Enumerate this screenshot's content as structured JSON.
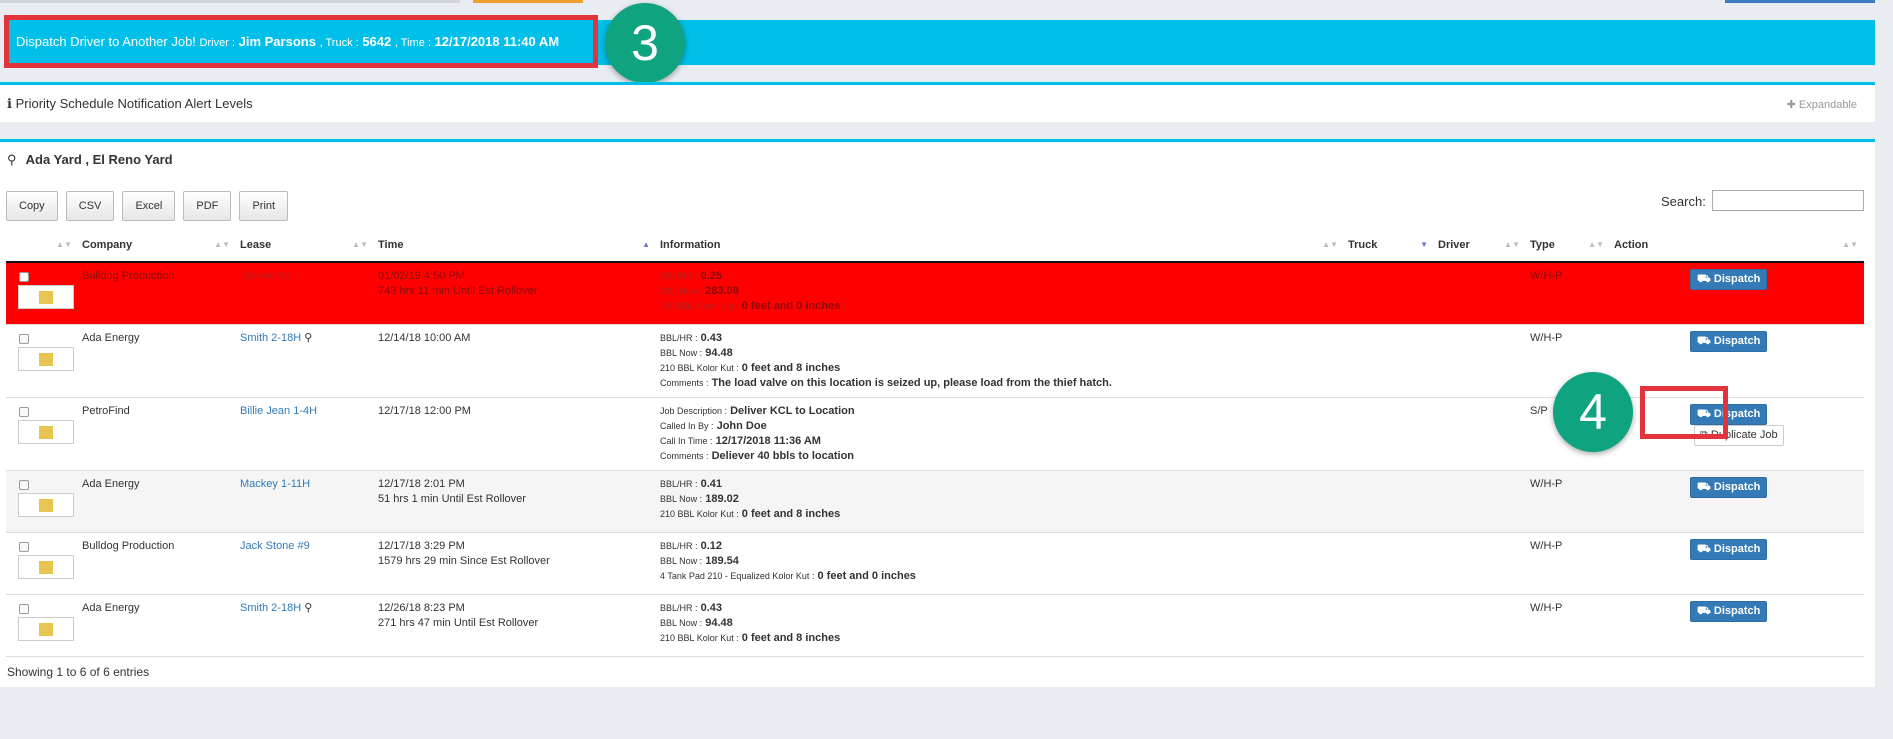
{
  "banner": {
    "title": "Dispatch Driver to Another Job!",
    "driver_label": "Driver :",
    "driver": "Jim Parsons",
    "truck_label": ", Truck :",
    "truck": "5642",
    "time_label": ", Time :",
    "time": "12/17/2018 11:40 AM"
  },
  "callouts": {
    "step3": "3",
    "step4": "4"
  },
  "alert_panel": {
    "title": "Priority Schedule Notification Alert Levels",
    "expand": "Expandable"
  },
  "yard": {
    "title": "Ada Yard , El Reno Yard"
  },
  "toolbar": {
    "buttons": [
      "Copy",
      "CSV",
      "Excel",
      "PDF",
      "Print"
    ],
    "search_label": "Search:"
  },
  "columns": [
    "",
    "Company",
    "Lease",
    "Time",
    "Information",
    "Truck",
    "Driver",
    "Type",
    "Action"
  ],
  "rows": [
    {
      "company": "Bulldog Production",
      "lease": "Denver #3",
      "has_pin": false,
      "time1": "01/02/19 4:50 PM",
      "time2": "749 hrs 11 min Until Est Rollover",
      "info": [
        {
          "label": "BBL/HR :",
          "value": "0.25"
        },
        {
          "label": "BBL Now :",
          "value": "283.08"
        },
        {
          "label": "300 BBL Kolor Kut :",
          "value": "0 feet and 0 inches"
        }
      ],
      "type": "W/H-P",
      "action": "Dispatch",
      "style": "red"
    },
    {
      "company": "Ada Energy",
      "lease": "Smith 2-18H",
      "has_pin": true,
      "time1": "12/14/18 10:00 AM",
      "time2": "",
      "info": [
        {
          "label": "BBL/HR :",
          "value": "0.43"
        },
        {
          "label": "BBL Now :",
          "value": "94.48"
        },
        {
          "label": "210 BBL Kolor Kut :",
          "value": "0 feet and 8 inches"
        },
        {
          "label": "Comments :",
          "value": "The load valve on this location is seized up, please load from the thief hatch."
        }
      ],
      "type": "W/H-P",
      "action": "Dispatch",
      "style": "white"
    },
    {
      "company": "PetroFind",
      "lease": "Billie Jean 1-4H",
      "has_pin": false,
      "time1": "12/17/18 12:00 PM",
      "time2": "",
      "info": [
        {
          "label": "Job Description :",
          "value": "Deliver KCL to Location"
        },
        {
          "label": "Called In By :",
          "value": "John Doe"
        },
        {
          "label": "Call In Time :",
          "value": "12/17/2018 11:36 AM"
        },
        {
          "label": "Comments :",
          "value": "Deliever 40 bbls to location"
        }
      ],
      "type": "S/P",
      "action": "Dispatch",
      "extra_action": "Duplicate Job",
      "style": "white"
    },
    {
      "company": "Ada Energy",
      "lease": "Mackey 1-11H",
      "has_pin": false,
      "time1": "12/17/18 2:01 PM",
      "time2": "51 hrs 1 min Until Est Rollover",
      "info": [
        {
          "label": "BBL/HR :",
          "value": "0.41"
        },
        {
          "label": "BBL Now :",
          "value": "189.02"
        },
        {
          "label": "210 BBL Kolor Kut :",
          "value": "0 feet and 8 inches"
        }
      ],
      "type": "W/H-P",
      "action": "Dispatch",
      "style": "alt"
    },
    {
      "company": "Bulldog Production",
      "lease": "Jack Stone #9",
      "has_pin": false,
      "time1": "12/17/18 3:29 PM",
      "time2": "1579 hrs 29 min Since Est Rollover",
      "info": [
        {
          "label": "BBL/HR :",
          "value": "0.12"
        },
        {
          "label": "BBL Now :",
          "value": "189.54"
        },
        {
          "label": "4 Tank Pad 210 - Equalized Kolor Kut :",
          "value": "0 feet and 0 inches"
        }
      ],
      "type": "W/H-P",
      "action": "Dispatch",
      "style": "white"
    },
    {
      "company": "Ada Energy",
      "lease": "Smith 2-18H",
      "has_pin": true,
      "time1": "12/26/18 8:23 PM",
      "time2": "271 hrs 47 min Until Est Rollover",
      "info": [
        {
          "label": "BBL/HR :",
          "value": "0.43"
        },
        {
          "label": "BBL Now :",
          "value": "94.48"
        },
        {
          "label": "210 BBL Kolor Kut :",
          "value": "0 feet and 8 inches"
        }
      ],
      "type": "W/H-P",
      "action": "Dispatch",
      "style": "white"
    }
  ],
  "footer": "Showing 1 to 6 of 6 entries"
}
